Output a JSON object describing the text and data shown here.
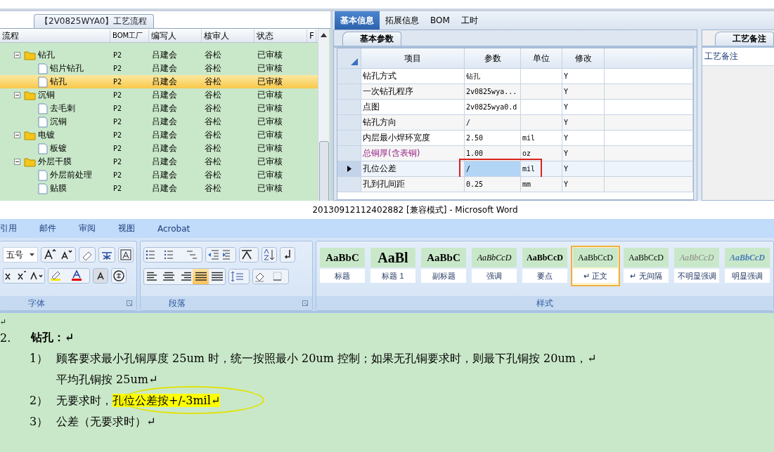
{
  "process_panel": {
    "title": "【2V0825WYA0】工艺流程",
    "columns": [
      "流程",
      "BOM工厂",
      "编写人",
      "核审人",
      "状态"
    ],
    "column_6": "F",
    "tree": [
      {
        "name": "钻孔",
        "kind": "folder",
        "expanded": true,
        "selected": false,
        "bom": "P2",
        "writer": "吕建会",
        "reviewer": "谷松",
        "status": "已审核",
        "children": [
          {
            "name": "铝片钻孔",
            "kind": "file",
            "selected": false,
            "bom": "P2",
            "writer": "吕建会",
            "reviewer": "谷松",
            "status": "已审核"
          },
          {
            "name": "钻孔",
            "kind": "file",
            "selected": true,
            "bom": "P2",
            "writer": "吕建会",
            "reviewer": "谷松",
            "status": "已审核"
          }
        ]
      },
      {
        "name": "沉铜",
        "kind": "folder",
        "expanded": true,
        "selected": false,
        "bom": "P2",
        "writer": "吕建会",
        "reviewer": "谷松",
        "status": "已审核",
        "children": [
          {
            "name": "去毛刺",
            "kind": "file",
            "selected": false,
            "bom": "P2",
            "writer": "吕建会",
            "reviewer": "谷松",
            "status": "已审核"
          },
          {
            "name": "沉铜",
            "kind": "file",
            "selected": false,
            "bom": "P2",
            "writer": "吕建会",
            "reviewer": "谷松",
            "status": "已审核"
          }
        ]
      },
      {
        "name": "电镀",
        "kind": "folder",
        "expanded": true,
        "selected": false,
        "bom": "P2",
        "writer": "吕建会",
        "reviewer": "谷松",
        "status": "已审核",
        "children": [
          {
            "name": "板镀",
            "kind": "file",
            "selected": false,
            "bom": "P2",
            "writer": "吕建会",
            "reviewer": "谷松",
            "status": "已审核"
          }
        ]
      },
      {
        "name": "外层干膜",
        "kind": "folder",
        "expanded": true,
        "selected": false,
        "bom": "P2",
        "writer": "吕建会",
        "reviewer": "谷松",
        "status": "已审核",
        "children": [
          {
            "name": "外层前处理",
            "kind": "file",
            "selected": false,
            "bom": "P2",
            "writer": "吕建会",
            "reviewer": "谷松",
            "status": "已审核"
          },
          {
            "name": "贴膜",
            "kind": "file",
            "selected": false,
            "bom": "P2",
            "writer": "吕建会",
            "reviewer": "谷松",
            "status": "已审核"
          }
        ]
      }
    ]
  },
  "detail_panel": {
    "tabs": [
      {
        "label": "基本信息",
        "selected": true
      },
      {
        "label": "拓展信息",
        "selected": false
      },
      {
        "label": "BOM",
        "selected": false
      },
      {
        "label": "工时",
        "selected": false
      }
    ],
    "subtab": "基本参数",
    "columns": [
      "项目",
      "参数",
      "单位",
      "修改"
    ],
    "rows": [
      {
        "item": "钻孔方式",
        "param": "钻孔",
        "modify": "Y",
        "current": false,
        "emphasis": false
      },
      {
        "item": "一次钻孔程序",
        "param": "2v0825wya...",
        "modify": "Y",
        "current": false,
        "emphasis": false
      },
      {
        "item": "点图",
        "param": "2v0825wya0.d",
        "modify": "Y",
        "current": false,
        "emphasis": false
      },
      {
        "item": "钻孔方向",
        "param": "/",
        "modify": "Y",
        "current": false,
        "emphasis": false
      },
      {
        "item": "内层最小焊环宽度",
        "param": "2.50",
        "unit": "mil",
        "modify": "Y",
        "current": false,
        "emphasis": false
      },
      {
        "item": "总铜厚(含表铜)",
        "param": "1.00",
        "unit": "oz",
        "modify": "Y",
        "current": false,
        "emphasis": true
      },
      {
        "item": "孔位公差",
        "param": "/",
        "unit": "mil",
        "modify": "Y",
        "current": true,
        "emphasis": false
      },
      {
        "item": "孔到孔间距",
        "param": "0.25",
        "unit": "mm",
        "modify": "Y",
        "current": false,
        "emphasis": false
      }
    ]
  },
  "notes_panel": {
    "tab": "工艺备注",
    "label": "工艺备注"
  },
  "word": {
    "title": "20130912112402882 [兼容模式] - Microsoft Word",
    "menu_tabs": [
      "引用",
      "邮件",
      "审阅",
      "视图",
      "Acrobat"
    ],
    "font_size": "五号",
    "font_group": "字体",
    "paragraph_group": "段落",
    "styles_group": "样式",
    "alignments": [
      {
        "kind": "left",
        "selected": false
      },
      {
        "kind": "center",
        "selected": false
      },
      {
        "kind": "right",
        "selected": false
      },
      {
        "kind": "justify",
        "selected": true
      },
      {
        "kind": "distributed",
        "selected": false
      }
    ],
    "styles": [
      {
        "sample": "AaBbC",
        "name": "标题",
        "kind": "heading",
        "selected": false
      },
      {
        "sample": "AaBl",
        "name": "标题 1",
        "kind": "big",
        "selected": false
      },
      {
        "sample": "AaBbC",
        "name": "副标题",
        "kind": "heading",
        "selected": false
      },
      {
        "sample": "AaBbCcD",
        "name": "强调",
        "kind": "italic",
        "selected": false
      },
      {
        "sample": "AaBbCcD",
        "name": "要点",
        "kind": "bold",
        "selected": false
      },
      {
        "sample": "AaBbCcD",
        "name": "↵ 正文",
        "kind": "plain",
        "selected": true
      },
      {
        "sample": "AaBbCcD",
        "name": "↵ 无间隔",
        "kind": "plain",
        "selected": false
      },
      {
        "sample": "AaBbCcD",
        "name": "不明显强调",
        "kind": "faint",
        "selected": false
      },
      {
        "sample": "AaBbCcD",
        "name": "明显强调",
        "kind": "strong",
        "selected": false
      }
    ]
  },
  "document": [
    {
      "kind": "mark",
      "text": "↵"
    },
    {
      "kind": "heading",
      "number": "2.",
      "parts": [
        {
          "text": "钻孔：↵",
          "highlight": false
        }
      ]
    },
    {
      "kind": "item",
      "number": "1）",
      "parts": [
        {
          "text": "顾客要求最小孔铜厚度 25um 时，统一按照最小 20um 控制；如果无孔铜要求时，则最下孔铜按 20um，↵",
          "highlight": false
        }
      ]
    },
    {
      "kind": "continuation",
      "parts": [
        {
          "text": "平均孔铜按 25um↵",
          "highlight": false
        }
      ]
    },
    {
      "kind": "item",
      "number": "2）",
      "parts": [
        {
          "text": "无要求时，",
          "highlight": false
        },
        {
          "text": "孔位公差按+/-3mil↵",
          "highlight": true
        }
      ],
      "circled": true
    },
    {
      "kind": "item",
      "number": "3）",
      "parts": [
        {
          "text": "公差（无要求时）↵",
          "highlight": false
        }
      ]
    }
  ]
}
